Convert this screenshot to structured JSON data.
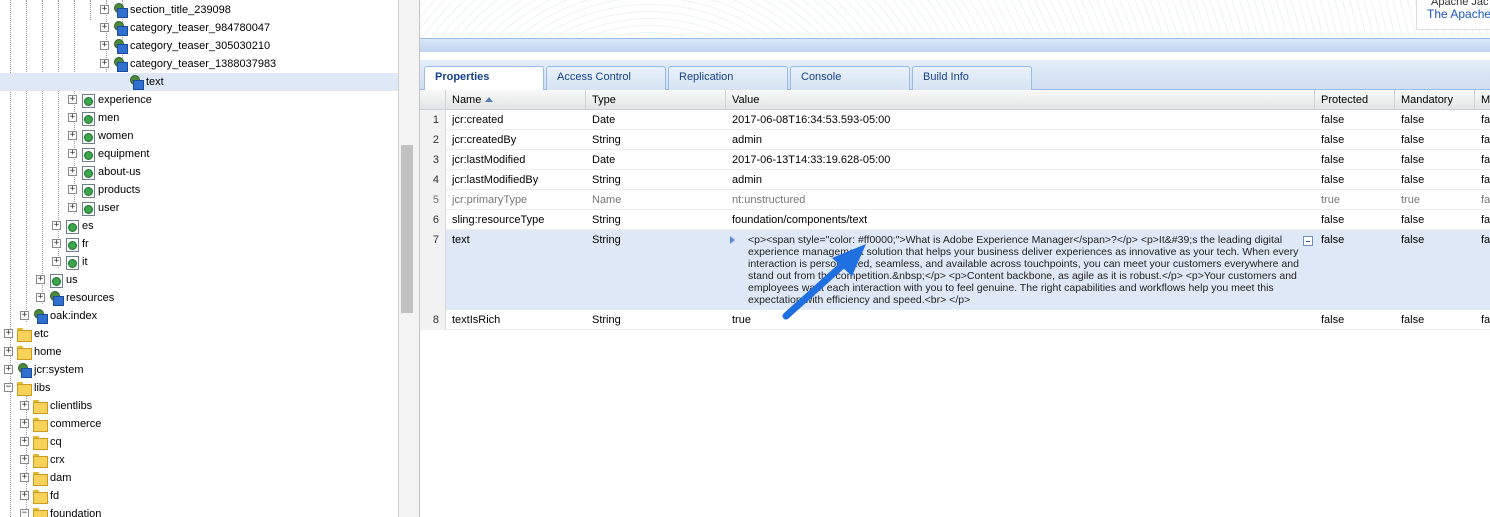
{
  "tree": {
    "items": [
      {
        "label": "section_title_239098",
        "icon": "node"
      },
      {
        "label": "category_teaser_984780047",
        "icon": "node"
      },
      {
        "label": "category_teaser_305030210",
        "icon": "node"
      },
      {
        "label": "category_teaser_1388037983",
        "icon": "node"
      },
      {
        "label": "text",
        "icon": "node",
        "selected": true
      },
      {
        "label": "experience",
        "icon": "page"
      },
      {
        "label": "men",
        "icon": "page"
      },
      {
        "label": "women",
        "icon": "page"
      },
      {
        "label": "equipment",
        "icon": "page"
      },
      {
        "label": "about-us",
        "icon": "page"
      },
      {
        "label": "products",
        "icon": "page"
      },
      {
        "label": "user",
        "icon": "page"
      },
      {
        "label": "es",
        "icon": "page"
      },
      {
        "label": "fr",
        "icon": "page"
      },
      {
        "label": "it",
        "icon": "page"
      },
      {
        "label": "us",
        "icon": "page"
      },
      {
        "label": "resources",
        "icon": "node"
      },
      {
        "label": "oak:index",
        "icon": "node"
      },
      {
        "label": "etc",
        "icon": "folder"
      },
      {
        "label": "home",
        "icon": "folder"
      },
      {
        "label": "jcr:system",
        "icon": "node"
      },
      {
        "label": "libs",
        "icon": "folder"
      },
      {
        "label": "clientlibs",
        "icon": "folder"
      },
      {
        "label": "commerce",
        "icon": "folder"
      },
      {
        "label": "cq",
        "icon": "folder"
      },
      {
        "label": "crx",
        "icon": "folder"
      },
      {
        "label": "dam",
        "icon": "folder"
      },
      {
        "label": "fd",
        "icon": "folder"
      },
      {
        "label": "foundation",
        "icon": "folder"
      }
    ]
  },
  "banner": {
    "line1": "Apache Jac",
    "line2": "The Apache"
  },
  "tabs": [
    {
      "label": "Properties",
      "active": true
    },
    {
      "label": "Access Control"
    },
    {
      "label": "Replication"
    },
    {
      "label": "Console"
    },
    {
      "label": "Build Info"
    }
  ],
  "grid": {
    "columns": [
      "Name",
      "Type",
      "Value",
      "Protected",
      "Mandatory",
      "M"
    ],
    "rows": [
      {
        "num": "1",
        "name": "jcr:created",
        "type": "Date",
        "value": "2017-06-08T16:34:53.593-05:00",
        "protected": "false",
        "mandatory": "false",
        "m": "fa"
      },
      {
        "num": "2",
        "name": "jcr:createdBy",
        "type": "String",
        "value": "admin",
        "protected": "false",
        "mandatory": "false",
        "m": "fa"
      },
      {
        "num": "3",
        "name": "jcr:lastModified",
        "type": "Date",
        "value": "2017-06-13T14:33:19.628-05:00",
        "protected": "false",
        "mandatory": "false",
        "m": "fa"
      },
      {
        "num": "4",
        "name": "jcr:lastModifiedBy",
        "type": "String",
        "value": "admin",
        "protected": "false",
        "mandatory": "false",
        "m": "fa"
      },
      {
        "num": "5",
        "name": "jcr:primaryType",
        "type": "Name",
        "value": "nt:unstructured",
        "protected": "true",
        "mandatory": "true",
        "m": "fa"
      },
      {
        "num": "6",
        "name": "sling:resourceType",
        "type": "String",
        "value": "foundation/components/text",
        "protected": "false",
        "mandatory": "false",
        "m": "fa"
      },
      {
        "num": "7",
        "name": "text",
        "type": "String",
        "value": "<p><span style=\"color: #ff0000;\">What is Adobe Experience Manager</span>?</p> <p>It&#39;s the leading digital experience management solution that helps your business deliver experiences as innovative as your tech. When every interaction is personalized, seamless, and available across touchpoints, you can meet your customers everywhere and stand out from the competition.&nbsp;</p> <p>Content backbone, as agile as it is robust.</p> <p>Your customers and employees want each interaction with you to feel genuine. The right capabilities and workflows help you meet this expectation with efficiency and speed.<br> </p>",
        "protected": "false",
        "mandatory": "false",
        "m": "fa"
      },
      {
        "num": "8",
        "name": "textIsRich",
        "type": "String",
        "value": "true",
        "protected": "false",
        "mandatory": "false",
        "m": "fa"
      }
    ]
  },
  "colors": {
    "accent": "#15428b",
    "selection": "#dfe8f6",
    "arrow": "#1f6fe0"
  }
}
